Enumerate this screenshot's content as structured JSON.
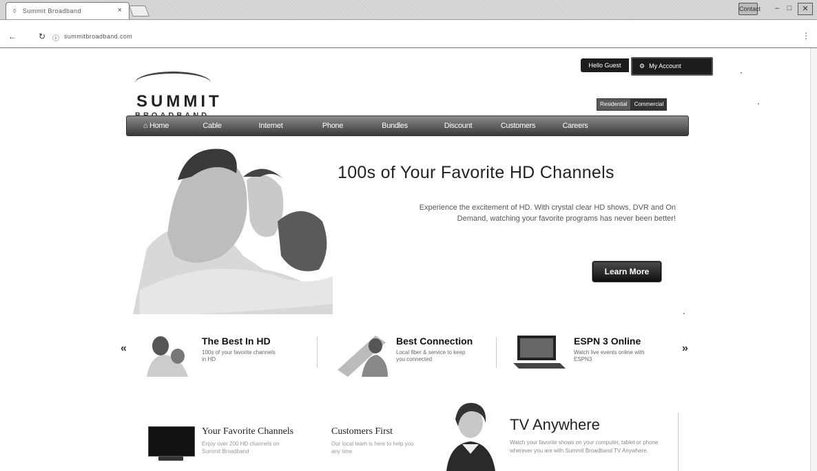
{
  "browser": {
    "tab_title": "Summit Broadband",
    "tab_close": "×",
    "address": "summitbroadband.com",
    "menu_glyph": "⋮",
    "back_glyph": "←",
    "reload_glyph": "↻",
    "window_controls": [
      "Contact",
      "–",
      "□",
      "✕"
    ]
  },
  "header": {
    "logo_top": "SUMMIT",
    "logo_bottom": "BROADBAND",
    "hello": "Hello Guest",
    "my_account": "My Account",
    "segment": [
      "Residential",
      "Commercial"
    ]
  },
  "nav": {
    "items": [
      "⌂ Home",
      "Cable",
      "Internet",
      "Phone",
      "Bundles",
      "Discount",
      "Customers",
      "Careers"
    ]
  },
  "hero": {
    "title": "100s of Your Favorite HD Channels",
    "body": "Experience the excitement of HD. With crystal clear HD shows, DVR and On Demand, watching your favorite programs has never been better!",
    "button": "Learn More"
  },
  "promos": {
    "prev": "«",
    "next": "»",
    "items": [
      {
        "heading": "The Best In HD",
        "body": "100s of your favorite channels in HD"
      },
      {
        "heading": "Best Connection",
        "body": "Local fiber & service to keep you connected"
      },
      {
        "heading": "ESPN 3 Online",
        "body": "Watch live events online with ESPN3"
      }
    ]
  },
  "bottom": {
    "card1_heading": "Your Favorite Channels",
    "card1_body": "Enjoy over 200 HD channels on Summit Broadband",
    "card2_heading": "Customers First",
    "card2_body": "Our local team is here to help you any time",
    "tv_title": "TV Anywhere",
    "tv_body": "Watch your favorite shows on your computer, tablet or phone wherever you are with Summit Broadband TV Anywhere."
  }
}
